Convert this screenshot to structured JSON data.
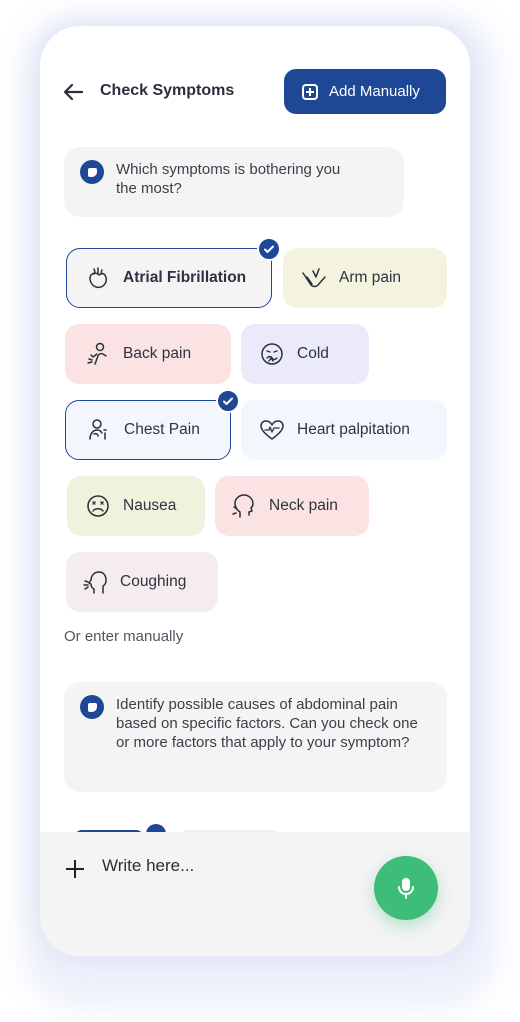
{
  "header": {
    "title": "Check Symptoms",
    "add_manually_label": "Add Manually"
  },
  "messages": [
    "Which symptoms is bothering you the most?",
    "Identify possible causes of abdominal pain based on specific factors. Can you check one or more factors that apply to your symptom?"
  ],
  "symptoms": [
    {
      "label": "Atrial Fibrillation",
      "icon": "heart-organ-icon",
      "selected": true
    },
    {
      "label": "Arm pain",
      "icon": "arm-icon",
      "selected": false
    },
    {
      "label": "Back pain",
      "icon": "back-pain-icon",
      "selected": false
    },
    {
      "label": "Cold",
      "icon": "sneeze-face-icon",
      "selected": false
    },
    {
      "label": "Chest Pain",
      "icon": "chest-pain-icon",
      "selected": true
    },
    {
      "label": "Heart palpitation",
      "icon": "heartbeat-icon",
      "selected": false
    },
    {
      "label": "Nausea",
      "icon": "nausea-face-icon",
      "selected": false
    },
    {
      "label": "Neck pain",
      "icon": "neck-icon",
      "selected": false
    },
    {
      "label": "Coughing",
      "icon": "cough-icon",
      "selected": false
    }
  ],
  "or_enter_manually": "Or enter manually",
  "composer": {
    "placeholder": "Write here..."
  },
  "colors": {
    "accent": "#1e4896",
    "mic": "#3dbd78"
  }
}
